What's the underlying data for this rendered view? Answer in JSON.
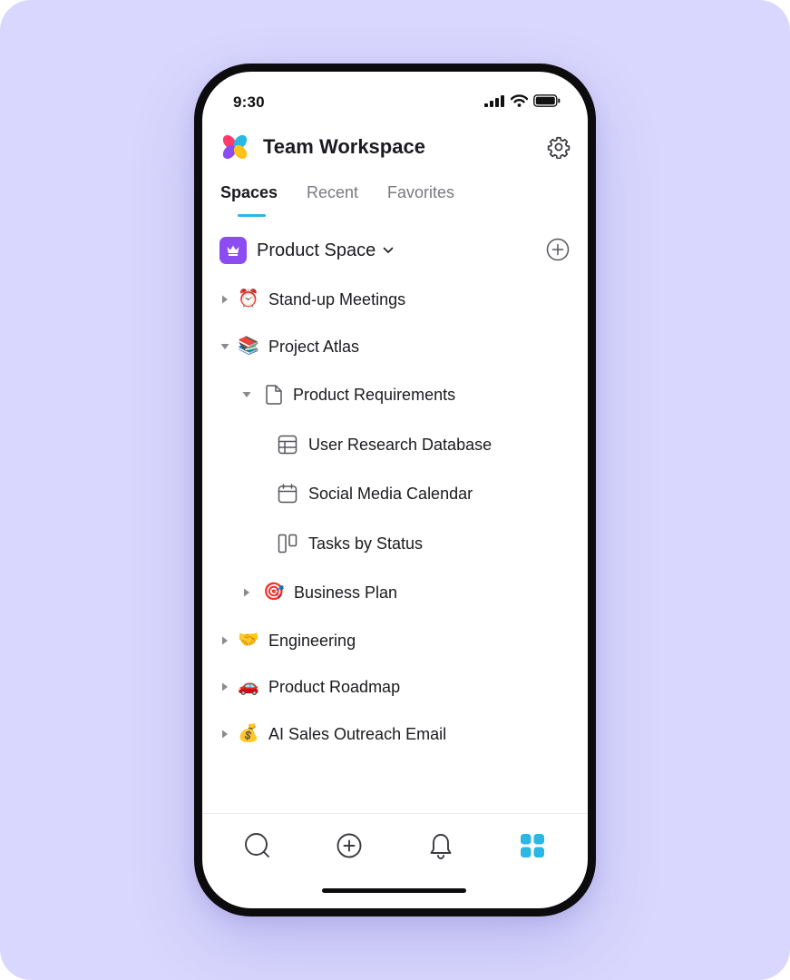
{
  "status_bar": {
    "time": "9:30"
  },
  "header": {
    "workspace_title": "Team Workspace"
  },
  "tabs": [
    {
      "label": "Spaces",
      "active": true
    },
    {
      "label": "Recent",
      "active": false
    },
    {
      "label": "Favorites",
      "active": false
    }
  ],
  "space": {
    "title": "Product Space"
  },
  "tree": [
    {
      "label": "Stand-up Meetings",
      "icon": "alarm-clock-emoji",
      "glyph": "⏰",
      "expanded": false
    },
    {
      "label": "Project Atlas",
      "icon": "books-emoji",
      "glyph": "📚",
      "expanded": true
    },
    {
      "label": "Product Requirements",
      "icon": "page-icon",
      "expanded": true
    },
    {
      "label": "User Research Database",
      "icon": "table-icon"
    },
    {
      "label": "Social Media Calendar",
      "icon": "calendar-icon"
    },
    {
      "label": "Tasks by Status",
      "icon": "board-icon"
    },
    {
      "label": "Business Plan",
      "icon": "target-emoji",
      "glyph": "🎯",
      "expanded": false
    },
    {
      "label": "Engineering",
      "icon": "handshake-emoji",
      "glyph": "🤝",
      "expanded": false
    },
    {
      "label": "Product Roadmap",
      "icon": "car-emoji",
      "glyph": "🚗",
      "expanded": false
    },
    {
      "label": "AI Sales Outreach Email",
      "icon": "money-bag-emoji",
      "glyph": "💰",
      "expanded": false
    }
  ],
  "bottom_nav": [
    {
      "icon": "search-icon"
    },
    {
      "icon": "add-circle-icon"
    },
    {
      "icon": "bell-icon"
    },
    {
      "icon": "spaces-grid-icon",
      "active": true
    }
  ],
  "colors": {
    "background": "#d9d7fd",
    "accent": "#2ab7e6",
    "space_badge": "#8b4cf2"
  }
}
